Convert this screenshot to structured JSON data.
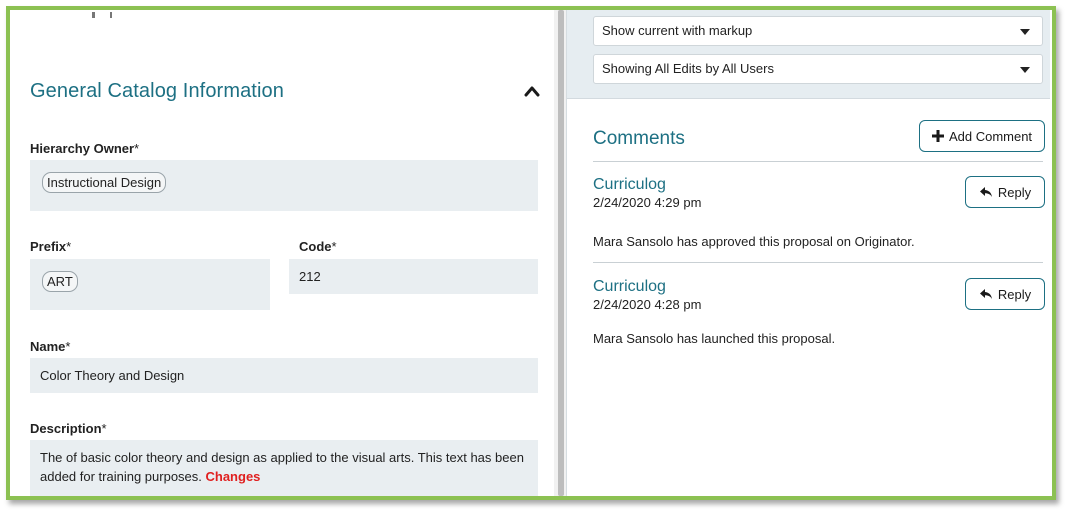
{
  "form": {
    "section_title": "General Catalog Information",
    "hierarchy_owner": {
      "label": "Hierarchy Owner",
      "required": "*",
      "value": "Instructional Design"
    },
    "prefix": {
      "label": "Prefix",
      "required": "*",
      "value": "ART"
    },
    "code": {
      "label": "Code",
      "required": "*",
      "value": "212"
    },
    "name": {
      "label": "Name",
      "required": "*",
      "value": "Color Theory and Design"
    },
    "description": {
      "label": "Description",
      "required": "*",
      "text": "The of basic color theory and design as applied to the visual arts. This text has been added for training purposes. ",
      "changes": "Changes"
    }
  },
  "markup": {
    "view_select": "Show current with markup",
    "edits_select": "Showing All Edits by All Users"
  },
  "comments": {
    "title": "Comments",
    "add_label": "Add Comment",
    "reply_label": "Reply",
    "items": [
      {
        "author": "Curriculog",
        "date": "2/24/2020 4:29 pm",
        "text": "Mara Sansolo has approved this proposal on Originator."
      },
      {
        "author": "Curriculog",
        "date": "2/24/2020 4:28 pm",
        "text": "Mara Sansolo has launched this proposal."
      }
    ]
  },
  "colors": {
    "accent": "#1d7083",
    "frame": "#8cc152",
    "field_bg": "#e9eef1",
    "changes": "#e02020"
  }
}
